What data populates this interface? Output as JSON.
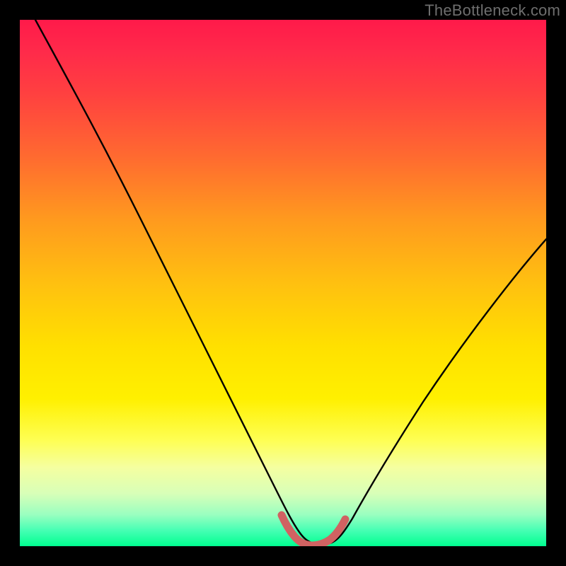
{
  "watermark": "TheBottleneck.com",
  "chart_data": {
    "type": "line",
    "title": "",
    "xlabel": "",
    "ylabel": "",
    "xlim": [
      0,
      100
    ],
    "ylim": [
      0,
      100
    ],
    "grid": false,
    "legend": false,
    "series": [
      {
        "name": "bottleneck-curve",
        "color": "#000000",
        "x": [
          3,
          10,
          20,
          30,
          40,
          48,
          50,
          53,
          55,
          57,
          60,
          65,
          70,
          80,
          90,
          100
        ],
        "y": [
          100,
          87,
          69,
          51,
          33,
          13,
          6,
          1,
          0.5,
          0.5,
          1,
          6,
          15,
          32,
          45,
          55
        ]
      },
      {
        "name": "optimal-zone-marker",
        "color": "#d16060",
        "x": [
          50,
          52,
          54,
          55,
          56,
          58,
          60
        ],
        "y": [
          6,
          2,
          0.8,
          0.5,
          0.8,
          2,
          6
        ]
      }
    ],
    "background": {
      "type": "vertical-gradient",
      "stops": [
        {
          "pos": 0,
          "color": "#ff1a4a"
        },
        {
          "pos": 50,
          "color": "#ffc010"
        },
        {
          "pos": 75,
          "color": "#fff000"
        },
        {
          "pos": 100,
          "color": "#00ff90"
        }
      ]
    }
  }
}
